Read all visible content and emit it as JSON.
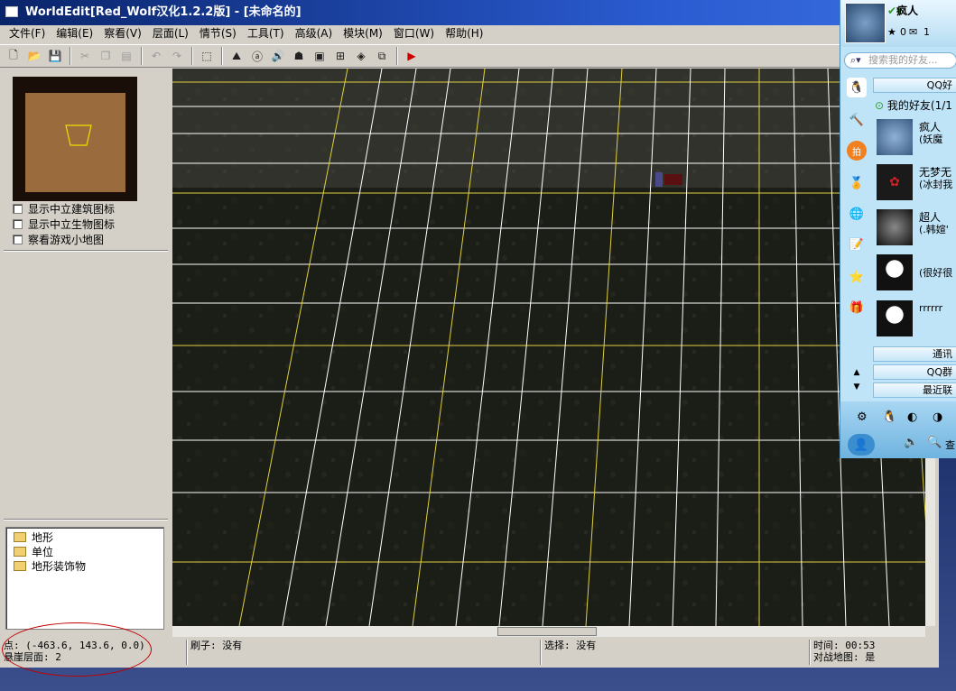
{
  "window": {
    "title": "WorldEdit[Red_Wolf汉化1.2.2版] - [未命名的]"
  },
  "menu": [
    "文件(F)",
    "编辑(E)",
    "察看(V)",
    "层面(L)",
    "情节(S)",
    "工具(T)",
    "高级(A)",
    "模块(M)",
    "窗口(W)",
    "帮助(H)"
  ],
  "left_panel": {
    "checkboxes": [
      "显示中立建筑图标",
      "显示中立生物图标",
      "察看游戏小地图"
    ],
    "tree": [
      "地形",
      "单位",
      "地形装饰物"
    ]
  },
  "status": {
    "point": "点: (-463.6, 143.6, 0.0)",
    "cliff_layer": "悬崖层面: 2",
    "brush": "刷子: 没有",
    "selection": "选择: 没有",
    "time": "时间: 00:53",
    "melee_map": "对战地图: 是"
  },
  "qq": {
    "nickname": "疯人",
    "mini_counts": [
      "0",
      "1"
    ],
    "search_placeholder": "搜索我的好友...",
    "tab_friends": "QQ好",
    "group_title": "我的好友(1/1",
    "friends": [
      {
        "name": "疯人",
        "status": "(妖魔"
      },
      {
        "name": "无梦无",
        "status": "(冰封我"
      },
      {
        "name": "超人",
        "status": "(.韩媗'"
      },
      {
        "name": "",
        "status": "(很好很"
      },
      {
        "name": "",
        "status": "rrrrrr"
      }
    ],
    "bars": [
      "通讯",
      "QQ群",
      "最近联"
    ],
    "bottom_search": "查"
  },
  "colors": {
    "title_blue": "#0a246a",
    "grid_white": "#ffffff",
    "grid_yellow": "#e0d040",
    "annotation_red": "#c00000"
  }
}
